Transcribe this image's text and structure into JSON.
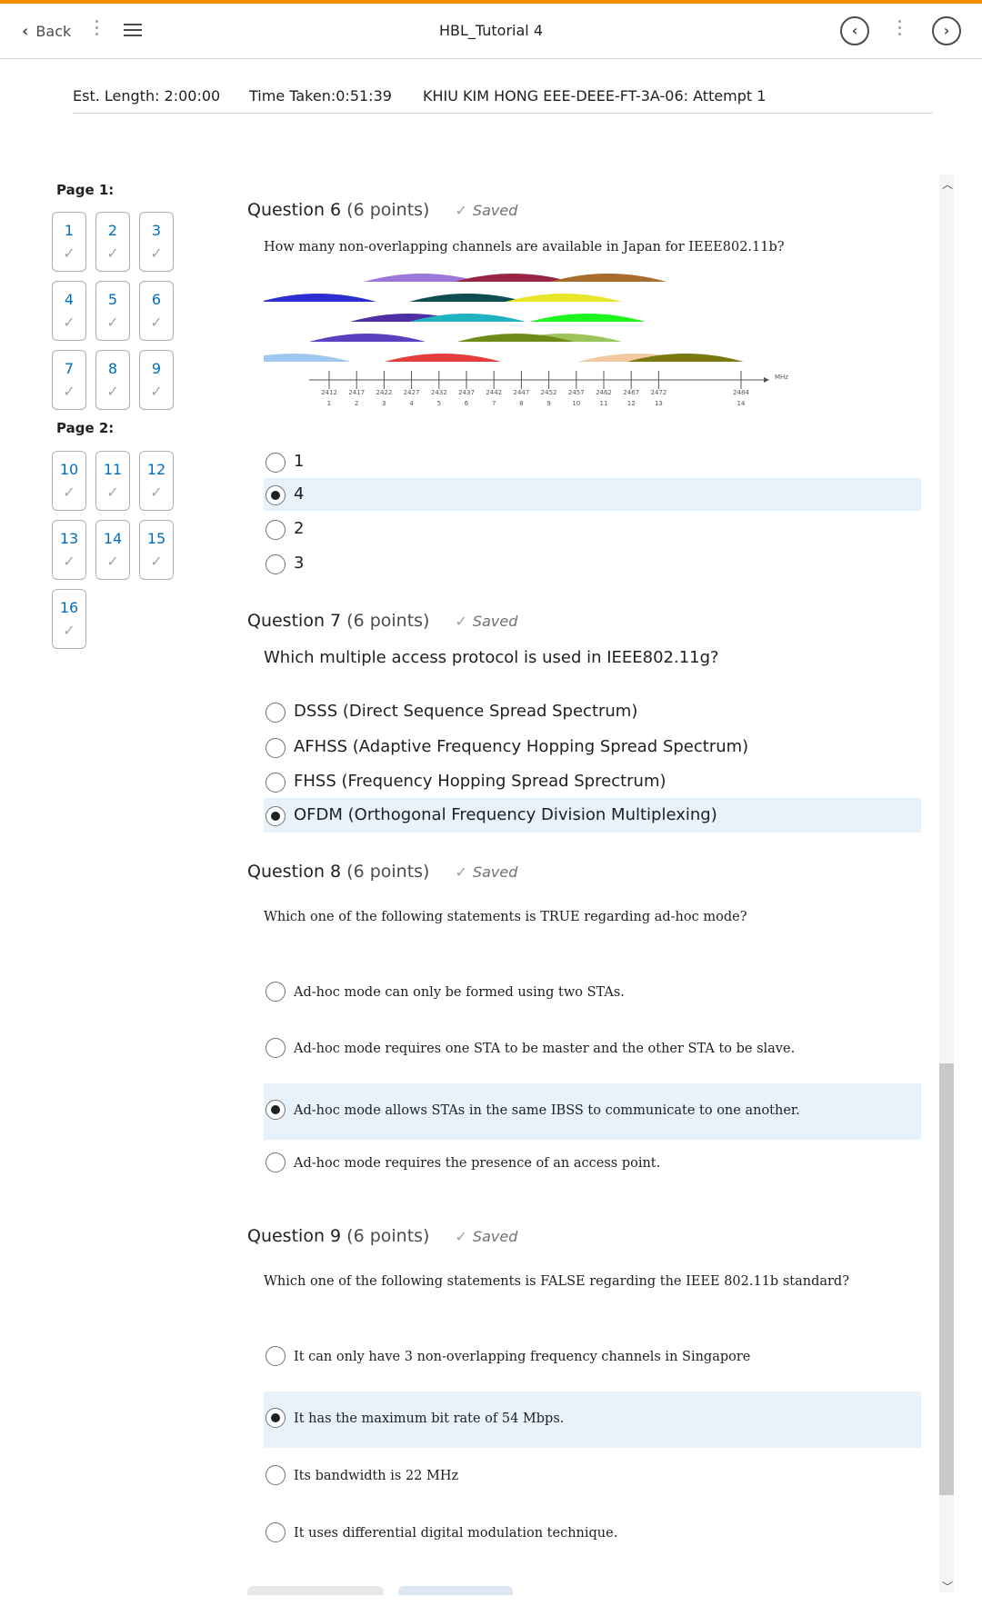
{
  "nav": {
    "back_label": "Back",
    "title": "HBL_Tutorial 4",
    "prev_glyph": "‹",
    "next_glyph": "›"
  },
  "info": {
    "est_length": "Est. Length: 2:00:00",
    "time_taken": "Time Taken:0:51:39",
    "attempt": "KHIU KIM HONG EEE-DEEE-FT-3A-06: Attempt 1"
  },
  "sidebar": {
    "page1_label": "Page 1:",
    "page2_label": "Page 2:",
    "check_glyph": "✓",
    "page1": [
      "1",
      "2",
      "3",
      "4",
      "5",
      "6",
      "7",
      "8",
      "9"
    ],
    "page2": [
      "10",
      "11",
      "12",
      "13",
      "14",
      "15",
      "16"
    ]
  },
  "questions": [
    {
      "title": "Question 6",
      "points": "(6 points)",
      "status": "Saved",
      "text": "How many non-overlapping channels are available in Japan for IEEE802.11b?",
      "options": [
        "1",
        "4",
        "2",
        "3"
      ],
      "selected": 1
    },
    {
      "title": "Question 7",
      "points": "(6 points)",
      "status": "Saved",
      "text": "Which multiple access protocol is used in IEEE802.11g?",
      "options": [
        "DSSS (Direct Sequence Spread Spectrum)",
        "AFHSS (Adaptive Frequency Hopping Spread Spectrum)",
        "FHSS (Frequency Hopping Spread Sprectrum)",
        "OFDM (Orthogonal Frequency Division Multiplexing)"
      ],
      "selected": 3
    },
    {
      "title": "Question 8",
      "points": "(6 points)",
      "status": "Saved",
      "text": "Which one of the following statements is TRUE regarding ad-hoc mode?",
      "options": [
        "Ad-hoc mode can only be formed using two STAs.",
        "Ad-hoc mode requires one STA to be master and the other STA to be slave.",
        "Ad-hoc mode allows STAs in the same IBSS to communicate to one another.",
        "Ad-hoc mode requires the presence of an access point."
      ],
      "selected": 2
    },
    {
      "title": "Question 9",
      "points": "(6 points)",
      "status": "Saved",
      "text": "Which one of the following statements is FALSE regarding the IEEE 802.11b standard?",
      "options": [
        "It can only have 3 non-overlapping frequency channels in Singapore",
        "It has the maximum bit rate of 54 Mbps.",
        "Its bandwidth is 22 MHz",
        "It uses differential digital modulation technique."
      ],
      "selected": 1
    }
  ],
  "channel_figure": {
    "unit": "MHz",
    "freqs": [
      "2412",
      "2417",
      "2422",
      "2427",
      "2432",
      "2437",
      "2442",
      "2447",
      "2452",
      "2457",
      "2462",
      "2467",
      "2472",
      "2484"
    ],
    "channels": [
      "1",
      "2",
      "3",
      "4",
      "5",
      "6",
      "7",
      "8",
      "9",
      "10",
      "11",
      "12",
      "13",
      "14"
    ],
    "arc_colors": [
      "#9fc8f0",
      "#5b3fc1",
      "#4e2fa6",
      "#2b2fd2",
      "#9a77d8",
      "#1fb2c0",
      "#0f4d50",
      "#e63c3c",
      "#9a2646",
      "#9bc45a",
      "#6e8b1a",
      "#e8e62a",
      "#1ef51e",
      "#f2c9a0",
      "#a86b2e",
      "#7a7a10"
    ]
  }
}
